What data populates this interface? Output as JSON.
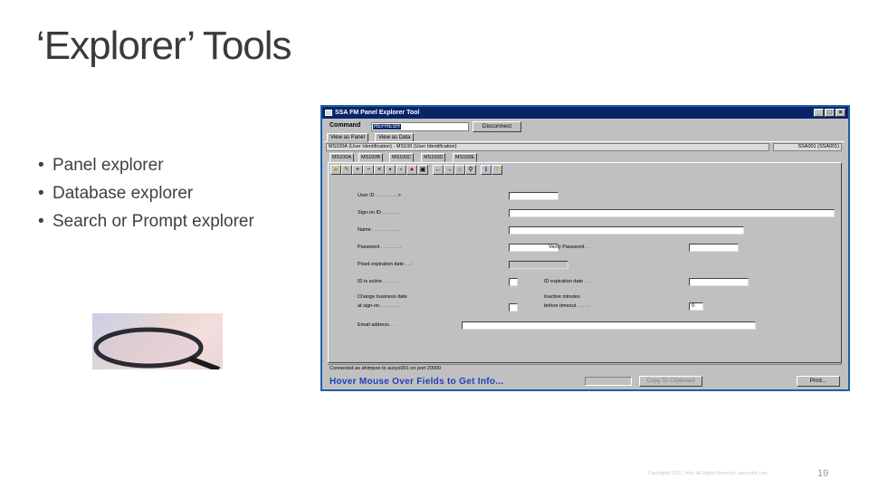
{
  "slide": {
    "title": "‘Explorer’ Tools",
    "bullets": [
      "Panel explorer",
      "Database explorer",
      "Search or Prompt explorer"
    ],
    "footer": "Copyright© 2012, Infor. All Rights Reserved. www.infor.com",
    "page_number": "19"
  },
  "app": {
    "window_title": "SSA FM Panel Explorer Tool",
    "window_buttons": [
      "_",
      "□",
      "×"
    ],
    "command_label": "Command",
    "command_value": "REFRESH",
    "disconnect_label": "Disconnect",
    "tabs": [
      "View as Panel",
      "View as Data"
    ],
    "panel_header": "MS100A (User Identification) - MS100 (User Identification)",
    "panel_header_right": "SSA001 (SSA001)",
    "subtabs": [
      "MS100A",
      "MS100B",
      "MS100C",
      "MS100D",
      "MS100E"
    ],
    "toolbar_icons": [
      "open-icon",
      "edit-icon",
      "add-icon",
      "minus-icon",
      "delete-icon",
      "save-icon",
      "clear-icon",
      "stop-icon",
      "bookmark-icon",
      "back-icon",
      "forward-icon",
      "home-icon",
      "link-icon",
      "info-icon",
      "help-icon"
    ],
    "fields": {
      "user_id": "User ID . . . . . . . . >",
      "sign_on_id": "Sign-on ID  . . . . . . .",
      "name": "Name  . . . . . . . . . .",
      "password": "Password  . . . . . . . .",
      "verify_password": "Verify Password . .",
      "pswd_expiration": "Pswd expiration date . . :",
      "id_is_active": "ID is active  . . . . . .",
      "id_expiration": "ID expiration date . . .",
      "change_business_date_1": "Change business date",
      "change_business_date_2": "at sign-on  . . . . . . .",
      "inactive_minutes_1": "Inactive minutes",
      "inactive_minutes_2": "before timeout . . . . .",
      "inactive_minutes_value": "0",
      "email_address": "Email address . ."
    },
    "status": "Connected as ahimpoo to ausys001 on port 20000",
    "hover_hint": "Hover Mouse Over Fields to Get Info...",
    "copy_label": "Copy To Clipboard",
    "print_label": "Print..."
  }
}
